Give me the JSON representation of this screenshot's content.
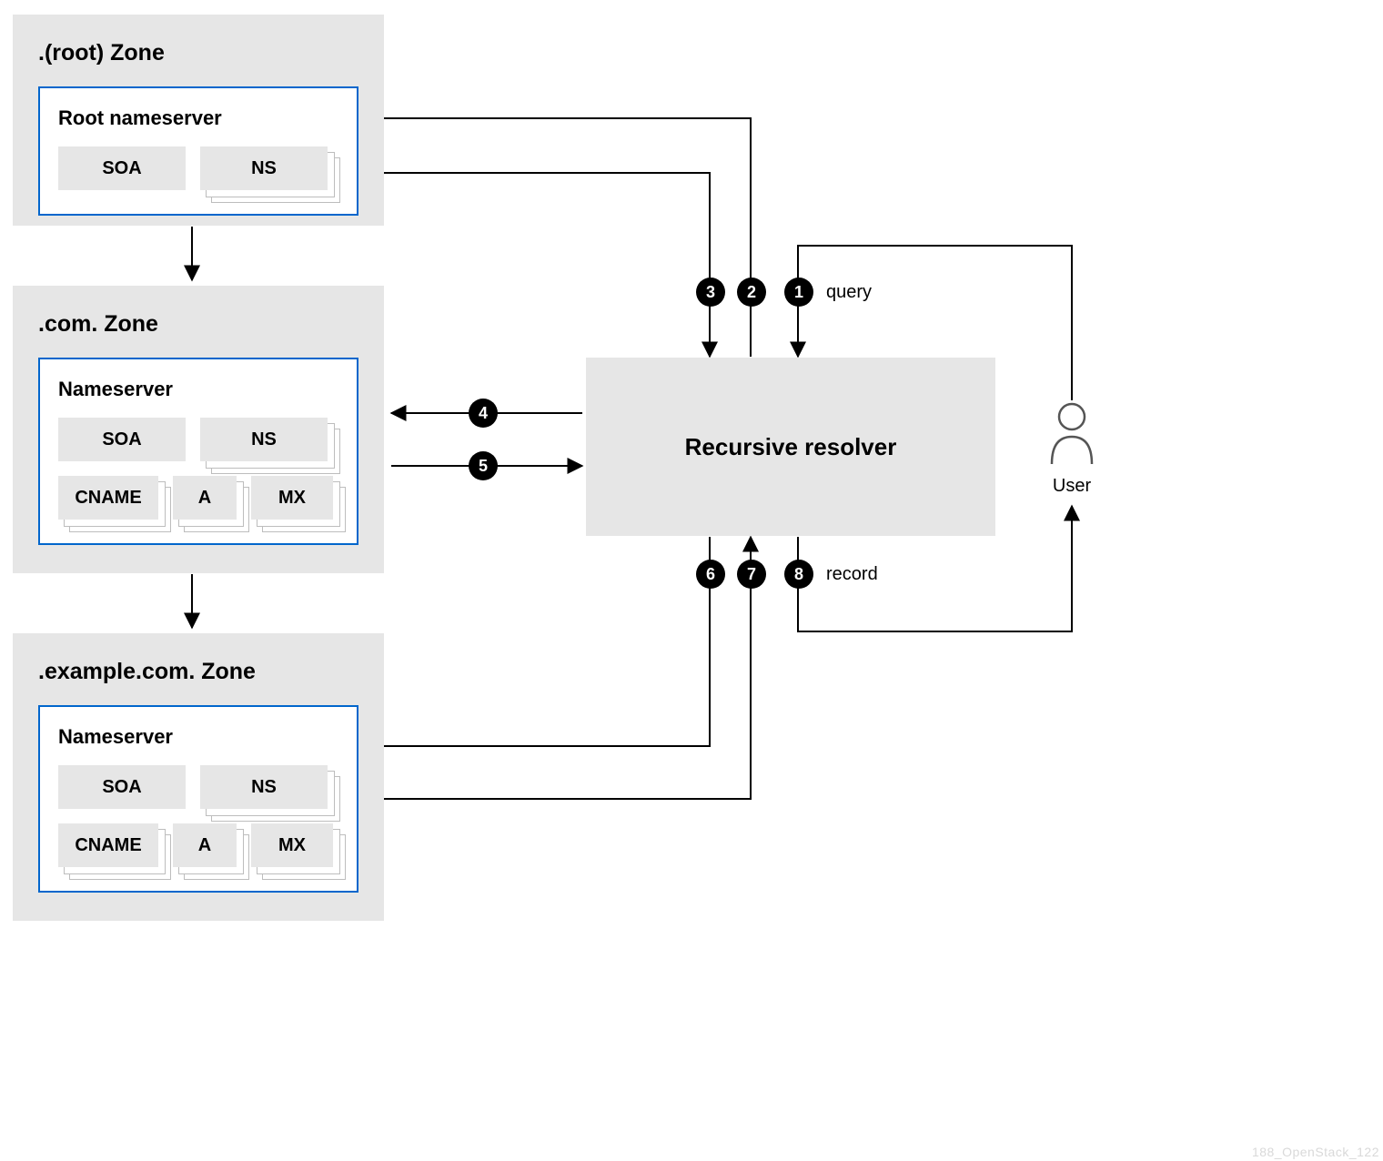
{
  "zones": {
    "root": {
      "title": ".(root) Zone",
      "nameserver_title": "Root nameserver",
      "records_row1": [
        "SOA",
        "NS"
      ]
    },
    "com": {
      "title": ".com. Zone",
      "nameserver_title": "Nameserver",
      "records_row1": [
        "SOA",
        "NS"
      ],
      "records_row2": [
        "CNAME",
        "A",
        "MX"
      ]
    },
    "example": {
      "title": ".example.com. Zone",
      "nameserver_title": "Nameserver",
      "records_row1": [
        "SOA",
        "NS"
      ],
      "records_row2": [
        "CNAME",
        "A",
        "MX"
      ]
    }
  },
  "resolver": {
    "label": "Recursive resolver"
  },
  "user": {
    "caption": "User"
  },
  "steps": {
    "s1": "1",
    "s2": "2",
    "s3": "3",
    "s4": "4",
    "s5": "5",
    "s6": "6",
    "s7": "7",
    "s8": "8"
  },
  "step_labels": {
    "query": "query",
    "record": "record"
  },
  "watermark": "188_OpenStack_122"
}
